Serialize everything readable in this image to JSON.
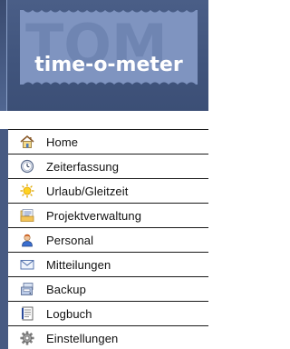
{
  "header": {
    "logo_text": "time-o-meter",
    "logo_watermark": "TOM"
  },
  "menu": {
    "items": [
      {
        "label": "Home",
        "icon": "home-icon"
      },
      {
        "label": "Zeiterfassung",
        "icon": "clock-icon"
      },
      {
        "label": "Urlaub/Gleitzeit",
        "icon": "sun-icon"
      },
      {
        "label": "Projektverwaltung",
        "icon": "projects-icon"
      },
      {
        "label": "Personal",
        "icon": "person-icon"
      },
      {
        "label": "Mitteilungen",
        "icon": "envelope-icon"
      },
      {
        "label": "Backup",
        "icon": "backup-icon"
      },
      {
        "label": "Logbuch",
        "icon": "logbook-icon"
      },
      {
        "label": "Einstellungen",
        "icon": "gear-icon"
      }
    ]
  },
  "colors": {
    "header_bg": "#44577e",
    "logo_stamp": "#7e93bf",
    "logo_text": "#ffffff",
    "menu_bar": "#475a82",
    "menu_text": "#111111",
    "divider": "#1a1a1a"
  }
}
